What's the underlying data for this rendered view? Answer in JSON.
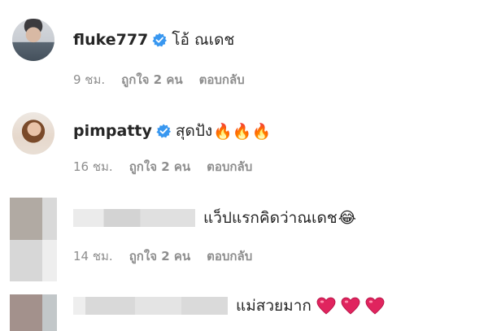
{
  "comments": [
    {
      "username": "fluke777",
      "text": "โอ้ ณเดช",
      "time": "9 ชม.",
      "likes": "ถูกใจ 2 คน",
      "reply": "ตอบกลับ",
      "verified": true,
      "avatar_icon": "profile-photo-man"
    },
    {
      "username": "pimpatty",
      "text": "สุดปัง",
      "emoji": "🔥🔥🔥",
      "time": "16 ชม.",
      "likes": "ถูกใจ 2 คน",
      "reply": "ตอบกลับ",
      "verified": true,
      "avatar_icon": "profile-photo-woman"
    },
    {
      "text": "แว็ปแรกคิดว่าณเดช",
      "emoji": "😂",
      "time": "14 ชม.",
      "likes": "ถูกใจ 2 คน",
      "reply": "ตอบกลับ",
      "avatar_icon": "blurred-avatar"
    },
    {
      "text": "แม่สวยมาก",
      "hearts": 3,
      "avatar_icon": "blurred-avatar"
    }
  ],
  "colors": {
    "verified_blue": "#3897f0",
    "meta_gray": "#8e8e8e",
    "heart_red": "#e0245e"
  }
}
